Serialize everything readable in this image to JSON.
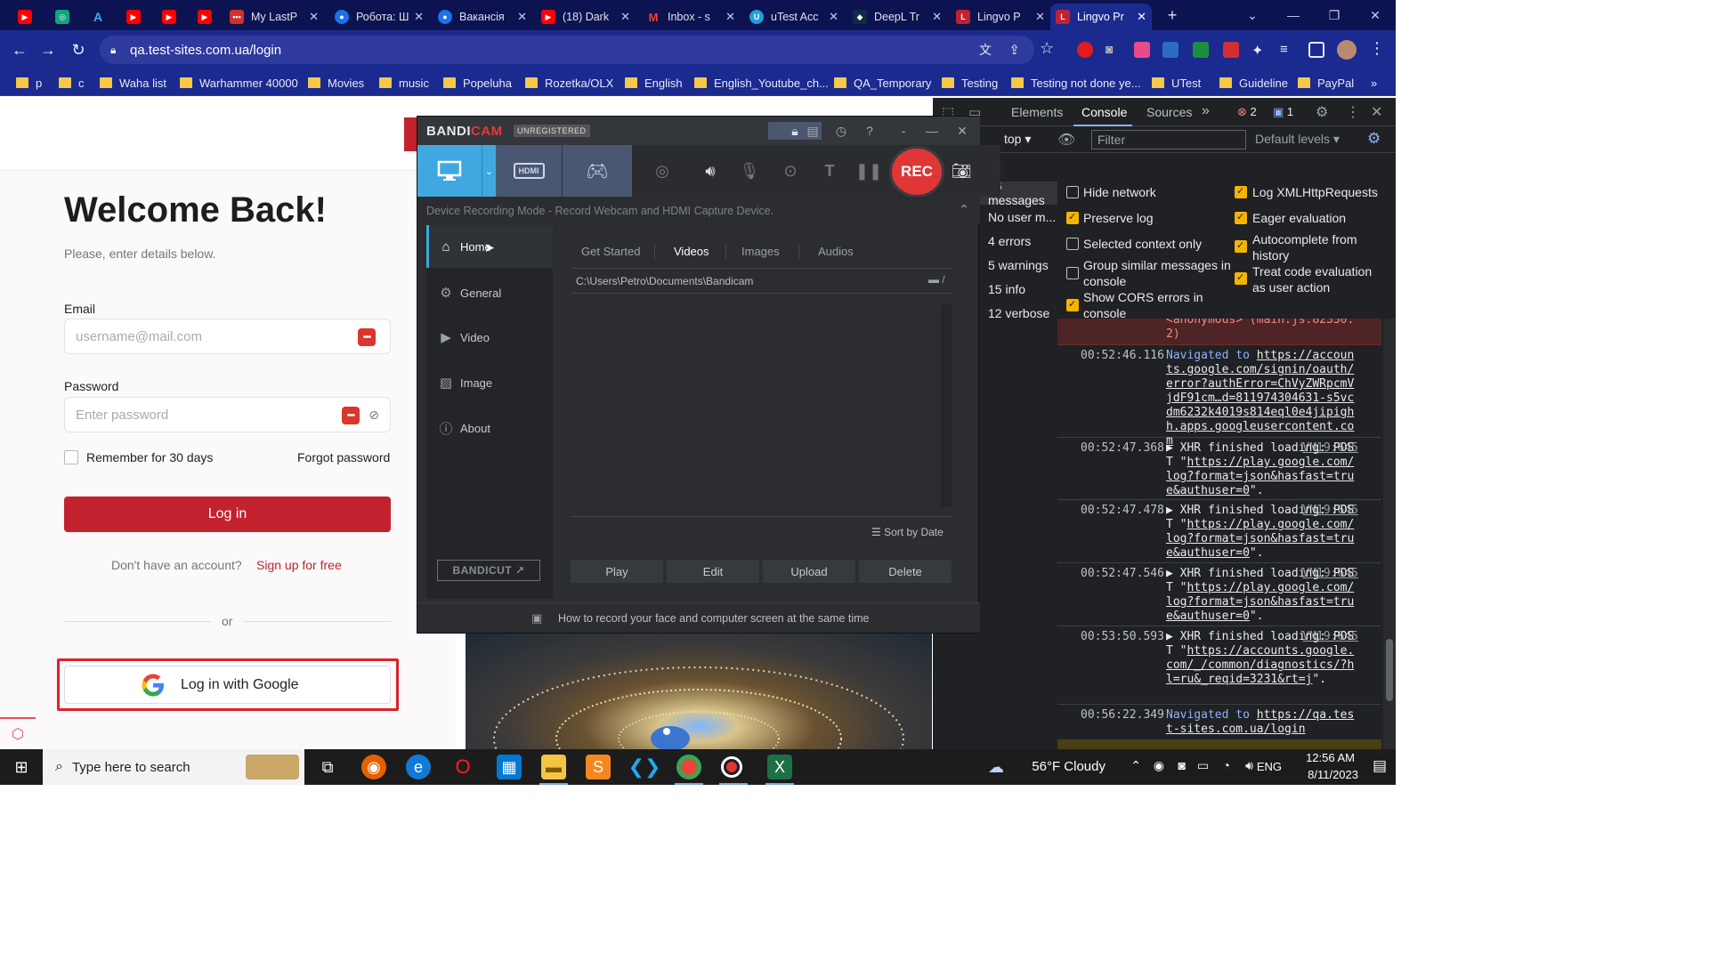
{
  "tabs": [
    {
      "title": "",
      "color": "#ff0000"
    },
    {
      "title": "",
      "color": "#10a37f"
    },
    {
      "title": "",
      "color": "#1a73e8"
    },
    {
      "title": "",
      "color": "#ff0000"
    },
    {
      "title": "",
      "color": "#ff0000"
    },
    {
      "title": "",
      "color": "#ff0000"
    },
    {
      "title": "My LastP",
      "color": "#d32f2f"
    },
    {
      "title": "Робота: Ш",
      "color": "#1a73e8"
    },
    {
      "title": "Вакансія",
      "color": "#1a73e8"
    },
    {
      "title": "(18) Dark",
      "color": "#ff0000"
    },
    {
      "title": "Inbox - s",
      "color": "#ea4335"
    },
    {
      "title": "uTest Acc",
      "color": "#1fa0d8"
    },
    {
      "title": "DeepL Tr",
      "color": "#0f2b46"
    },
    {
      "title": "Lingvo P",
      "color": "#c1222e"
    },
    {
      "title": "Lingvo Pr",
      "color": "#c1222e"
    }
  ],
  "browser": {
    "url": "qa.test-sites.com.ua/login",
    "bookmarks": [
      "p",
      "c",
      "Waha list",
      "Warhammer 40000",
      "Movies",
      "music",
      "Popeluha",
      "Rozetka/OLX",
      "English",
      "English_Youtube_ch...",
      "QA_Temporary",
      "Testing",
      "Testing not done ye...",
      "UTest",
      "Guideline",
      "PayPal"
    ],
    "more": "»"
  },
  "login": {
    "title": "Welcome Back!",
    "subtitle": "Please, enter details below.",
    "email_label": "Email",
    "email_placeholder": "username@mail.com",
    "password_label": "Password",
    "password_placeholder": "Enter password",
    "remember": "Remember for 30 days",
    "forgot": "Forgot password",
    "login_button": "Log in",
    "no_account": "Don't have an account?",
    "signup": "Sign up for free",
    "or": "or",
    "google": "Log in with Google"
  },
  "devtools": {
    "tabs": [
      "Elements",
      "Console",
      "Sources"
    ],
    "more": "»",
    "errors": "2",
    "messages": "1",
    "context": "top",
    "filter_placeholder": "Filter",
    "levels": "Default levels",
    "issues": "1",
    "sidebar": [
      "36 messages",
      "No user m...",
      "4 errors",
      "5 warnings",
      "15 info",
      "12 verbose"
    ],
    "settings": [
      {
        "label": "Hide network",
        "checked": false
      },
      {
        "label": "Preserve log",
        "checked": true
      },
      {
        "label": "Selected context only",
        "checked": false
      },
      {
        "label": "Group similar messages in console",
        "checked": false
      },
      {
        "label": "Show CORS errors in console",
        "checked": true
      },
      {
        "label": "Log XMLHttpRequests",
        "checked": true
      },
      {
        "label": "Eager evaluation",
        "checked": true
      },
      {
        "label": "Autocomplete from history",
        "checked": true
      },
      {
        "label": "Treat code evaluation as user action",
        "checked": true
      }
    ],
    "log": [
      {
        "time": "",
        "text": "<anonymous> (main.js:82330:2)",
        "kind": "error"
      },
      {
        "time": "00:52:46.116",
        "prefix": "Navigated to",
        "text": "https://accounts.google.com/signin/oauth/error?authError=ChVyZWRpcmVjdF91cm…d=811974304631-s5vcdm6232k4019s814eql0e4jipighh.apps.googleusercontent.com",
        "kind": "nav"
      },
      {
        "time": "00:52:47.368",
        "prefix": "▶ XHR finished loading: POST \"",
        "text": "https://play.google.com/log?format=json&hasfast=true&authuser=0",
        "suffix": "\".",
        "vm": "VM19:645",
        "kind": "xhr"
      },
      {
        "time": "00:52:47.478",
        "prefix": "▶ XHR finished loading: POST \"",
        "text": "https://play.google.com/log?format=json&hasfast=true&authuser=0",
        "suffix": "\".",
        "vm": "VM19:645",
        "kind": "xhr"
      },
      {
        "time": "00:52:47.546",
        "prefix": "▶ XHR finished loading: POST \"",
        "text": "https://play.google.com/log?format=json&hasfast=true&authuser=0",
        "suffix": "\".",
        "vm": "VM19:645",
        "kind": "xhr"
      },
      {
        "time": "00:53:50.593",
        "prefix": "▶ XHR finished loading: POST \"",
        "text": "https://accounts.google.com/_/common/diagnostics/?hl=ru&_reqid=3231&rt=j",
        "suffix": "\".",
        "vm": "VM19:645",
        "kind": "xhr"
      },
      {
        "time": "00:56:22.349",
        "prefix": "Navigated to",
        "text": "https://qa.test-sites.com.ua/login",
        "kind": "nav"
      }
    ]
  },
  "bandicam": {
    "logo_a": "BANDI",
    "logo_b": "CAM",
    "unregistered": "UNREGISTERED",
    "rec": "REC",
    "mode_text": "Device Recording Mode - Record Webcam and HDMI Capture Device.",
    "hdmi": "HDMI",
    "nav": [
      "Home",
      "General",
      "Video",
      "Image",
      "About"
    ],
    "subtabs": [
      "Get Started",
      "Videos",
      "Images",
      "Audios"
    ],
    "path": "C:\\Users\\Petro\\Documents\\Bandicam",
    "path_btn": "/",
    "sort": "Sort by Date",
    "actions": [
      "Play",
      "Edit",
      "Upload",
      "Delete"
    ],
    "bandicut": "BANDICUT",
    "tip": "How to record your face and computer screen at the same time"
  },
  "taskbar": {
    "search": "Type here to search",
    "weather": "56°F  Cloudy",
    "lang": "ENG",
    "time": "12:56 AM",
    "date": "8/11/2023"
  },
  "colors": {
    "brand_red": "#c1222e",
    "chrome_dark": "#0c1350",
    "chrome_bar": "#1b2a8f",
    "devtools_bg": "#202124",
    "checkbox_on": "#f4b400"
  }
}
